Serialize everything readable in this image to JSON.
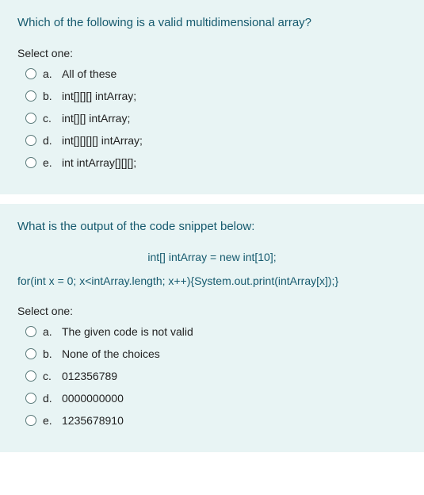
{
  "questions": [
    {
      "prompt": "Which of the following is a valid multidimensional array?",
      "select_label": "Select one:",
      "options": [
        {
          "letter": "a.",
          "text": "All of these"
        },
        {
          "letter": "b.",
          "text": "int[][][] intArray;"
        },
        {
          "letter": "c.",
          "text": "int[][] intArray;"
        },
        {
          "letter": "d.",
          "text": "int[][][][] intArray;"
        },
        {
          "letter": "e.",
          "text": "int intArray[][][];"
        }
      ]
    },
    {
      "prompt": "What is the output of the code snippet below:",
      "code_center": "int[] intArray = new int[10];",
      "code_line": "for(int x = 0; x<intArray.length; x++){System.out.print(intArray[x]);}",
      "select_label": "Select one:",
      "options": [
        {
          "letter": "a.",
          "text": "The given code is not valid"
        },
        {
          "letter": "b.",
          "text": "None of the choices"
        },
        {
          "letter": "c.",
          "text": "012356789"
        },
        {
          "letter": "d.",
          "text": "0000000000"
        },
        {
          "letter": "e.",
          "text": "1235678910"
        }
      ]
    }
  ]
}
